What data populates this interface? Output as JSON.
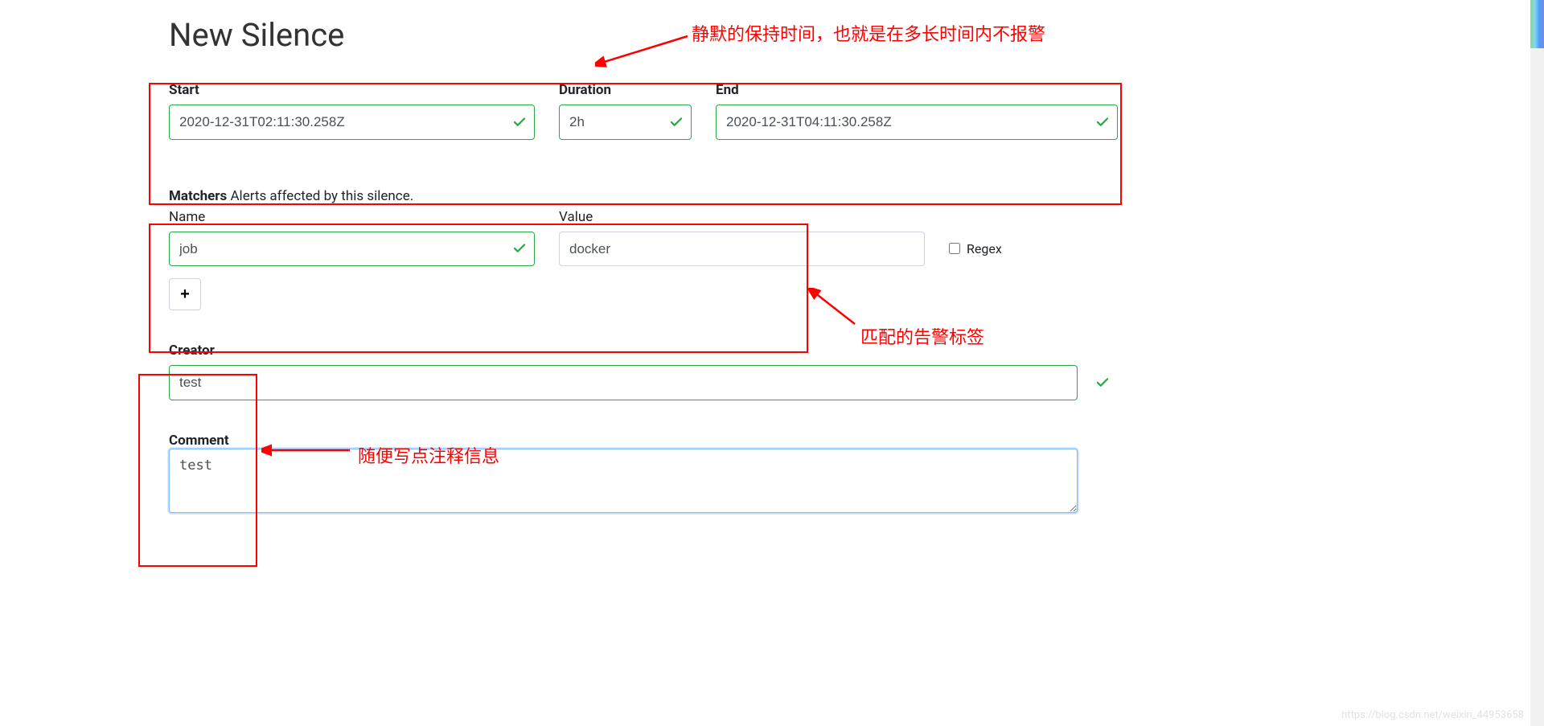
{
  "title": "New Silence",
  "time": {
    "start_label": "Start",
    "start_value": "2020-12-31T02:11:30.258Z",
    "duration_label": "Duration",
    "duration_value": "2h",
    "end_label": "End",
    "end_value": "2020-12-31T04:11:30.258Z"
  },
  "matchers": {
    "heading_bold": "Matchers",
    "heading_rest": " Alerts affected by this silence.",
    "name_label": "Name",
    "value_label": "Value",
    "name_value": "job",
    "value_value": "docker",
    "regex_label": "Regex",
    "plus": "+"
  },
  "creator": {
    "label": "Creator",
    "value": "test"
  },
  "comment": {
    "label": "Comment",
    "value": "test"
  },
  "annotations": {
    "top": "静默的保持时间，也就是在多长时间内不报警",
    "matcher": "匹配的告警标签",
    "creator": "随便写点注释信息"
  },
  "watermark": "https://blog.csdn.net/weixin_44953658"
}
